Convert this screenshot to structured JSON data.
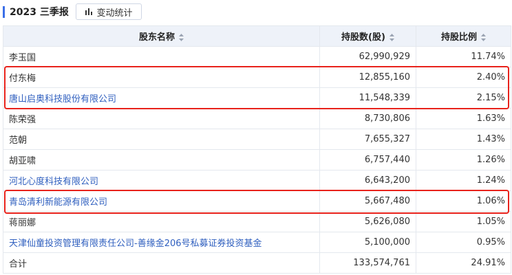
{
  "header": {
    "period_title": "2023 三季报",
    "stats_button_label": "变动统计"
  },
  "table": {
    "columns": [
      "股东名称",
      "持股数(股)",
      "持股比例"
    ],
    "rows": [
      {
        "name": "李玉国",
        "shares": "62,990,929",
        "ratio": "11.74%",
        "link": false
      },
      {
        "name": "付东梅",
        "shares": "12,855,160",
        "ratio": "2.40%",
        "link": false
      },
      {
        "name": "唐山启奥科技股份有限公司",
        "shares": "11,548,339",
        "ratio": "2.15%",
        "link": true
      },
      {
        "name": "陈荣强",
        "shares": "8,730,806",
        "ratio": "1.63%",
        "link": false
      },
      {
        "name": "范朝",
        "shares": "7,655,327",
        "ratio": "1.43%",
        "link": false
      },
      {
        "name": "胡亚啸",
        "shares": "6,757,440",
        "ratio": "1.26%",
        "link": false
      },
      {
        "name": "河北心度科技有限公司",
        "shares": "6,643,200",
        "ratio": "1.24%",
        "link": true
      },
      {
        "name": "青岛清利新能源有限公司",
        "shares": "5,667,480",
        "ratio": "1.06%",
        "link": true
      },
      {
        "name": "蒋丽娜",
        "shares": "5,626,080",
        "ratio": "1.05%",
        "link": false
      },
      {
        "name": "天津仙童投资管理有限责任公司-善缘金206号私募证券投资基金",
        "shares": "5,100,000",
        "ratio": "0.95%",
        "link": true
      },
      {
        "name": "合计",
        "shares": "133,574,761",
        "ratio": "24.91%",
        "link": false
      }
    ]
  },
  "colors": {
    "accent": "#3a6ee8",
    "link": "#2f5fbf",
    "highlight": "#e8221b",
    "header_bg": "#eef2f9"
  },
  "icons": {
    "stats_button": "bar-chart-icon",
    "sort": "sort-icon"
  }
}
